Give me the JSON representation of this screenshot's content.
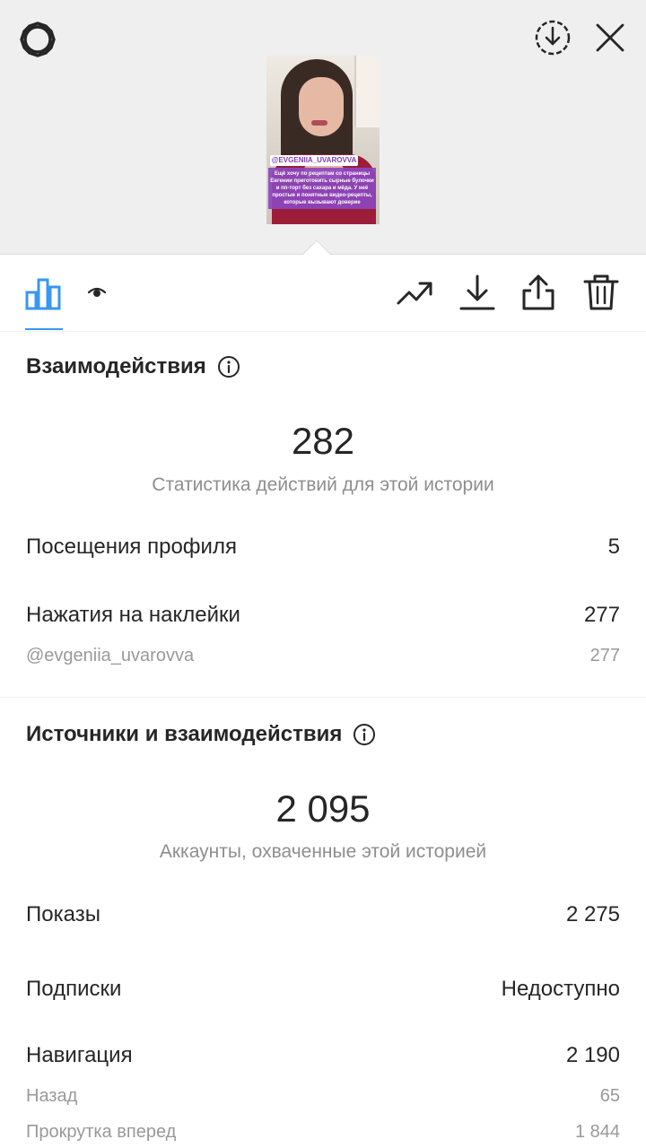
{
  "header": {
    "settings_icon": "gear-icon",
    "download_icon": "download-circle-icon",
    "close_icon": "close-icon"
  },
  "story_preview": {
    "mention_text": "@EVGENIIA_UVAROVVA",
    "caption_text": "Ещё хочу по рецептам со страницы Евгении приготовить сырные булочки и пп-торт без сахара и мёда. У неё простые и понятные видео-рецепты, которые вызывают доверие"
  },
  "toolbar": {
    "insights_icon": "bar-chart-icon",
    "viewers_icon": "eye-icon",
    "promote_icon": "trending-up-icon",
    "save_icon": "download-icon",
    "share_icon": "share-icon",
    "delete_icon": "trash-icon",
    "accent_color": "#3897f0"
  },
  "interactions": {
    "title": "Взаимодействия",
    "total": "282",
    "caption": "Статистика действий для этой истории",
    "rows": [
      {
        "label": "Посещения профиля",
        "value": "5"
      },
      {
        "label": "Нажатия на наклейки",
        "value": "277"
      }
    ],
    "sub_rows": [
      {
        "label": "@evgeniia_uvarovva",
        "value": "277"
      }
    ]
  },
  "discovery": {
    "title": "Источники и взаимодействия",
    "total": "2 095",
    "caption": "Аккаунты, охваченные этой историей",
    "rows": [
      {
        "label": "Показы",
        "value": "2 275"
      },
      {
        "label": "Подписки",
        "value": "Недоступно"
      },
      {
        "label": "Навигация",
        "value": "2 190"
      }
    ],
    "sub_rows": [
      {
        "label": "Назад",
        "value": "65"
      },
      {
        "label": "Прокрутка вперед",
        "value": "1 844"
      }
    ]
  }
}
